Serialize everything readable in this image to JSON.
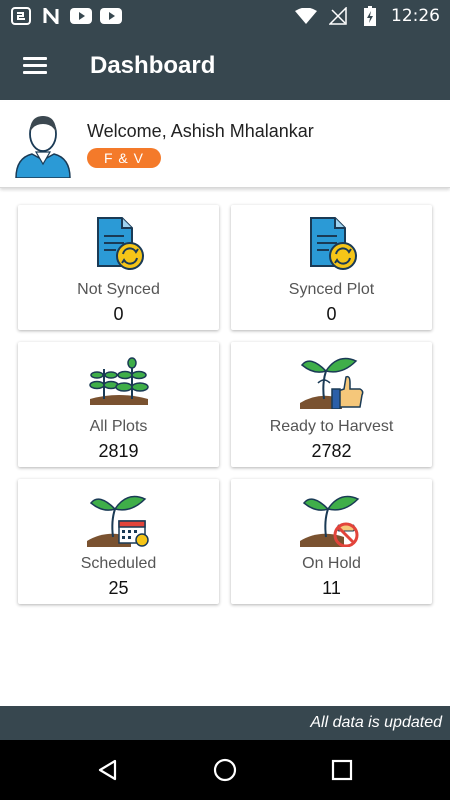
{
  "status_bar": {
    "time": "12:26",
    "left_icons": [
      "app-notification-icon",
      "n-icon",
      "youtube-icon",
      "youtube-icon"
    ],
    "right_icons": [
      "wifi-icon",
      "no-signal-icon",
      "battery-charging-icon"
    ]
  },
  "app_bar": {
    "title": "Dashboard",
    "menu_icon": "hamburger-menu-icon",
    "background": "#37474f"
  },
  "profile": {
    "welcome": "Welcome, Ashish Mhalankar",
    "badge": "F & V",
    "badge_color": "#f47a2a"
  },
  "cards": [
    {
      "label": "Not Synced",
      "value": "0",
      "icon": "document-sync-icon"
    },
    {
      "label": "Synced Plot",
      "value": "0",
      "icon": "document-sync-icon"
    },
    {
      "label": "All Plots",
      "value": "2819",
      "icon": "plants-icon"
    },
    {
      "label": "Ready to Harvest",
      "value": "2782",
      "icon": "sprout-thumbs-up-icon"
    },
    {
      "label": "Scheduled",
      "value": "25",
      "icon": "sprout-calendar-icon"
    },
    {
      "label": "On Hold",
      "value": "11",
      "icon": "sprout-prohibited-icon"
    }
  ],
  "footer": {
    "status_text": "All data is updated"
  },
  "nav_bar": {
    "buttons": [
      "back-icon",
      "home-icon",
      "recents-icon"
    ]
  }
}
